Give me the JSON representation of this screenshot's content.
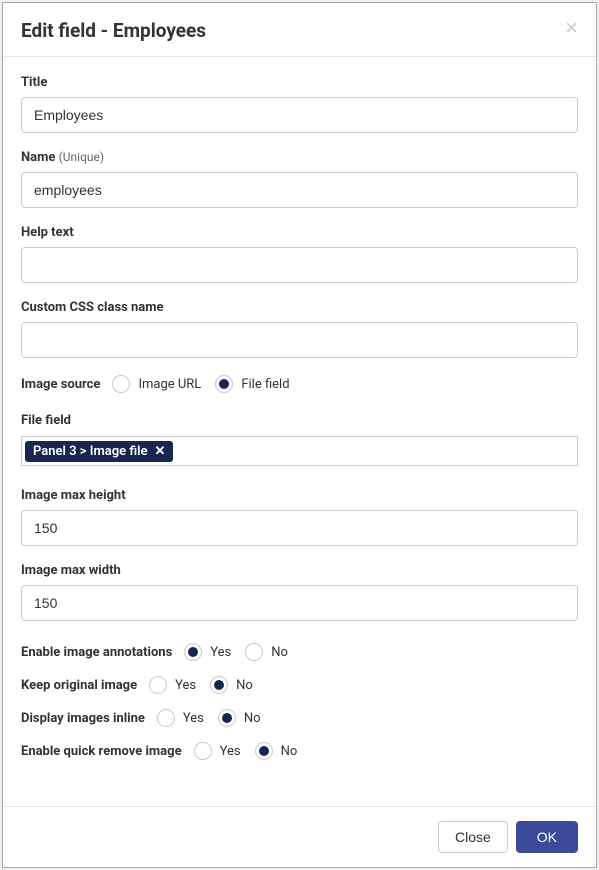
{
  "modal": {
    "title": "Edit field - Employees",
    "close_label": "×"
  },
  "fields": {
    "title": {
      "label": "Title",
      "value": "Employees"
    },
    "name": {
      "label": "Name",
      "hint": "(Unique)",
      "value": "employees"
    },
    "help_text": {
      "label": "Help text",
      "value": ""
    },
    "css_class": {
      "label": "Custom CSS class name",
      "value": ""
    },
    "image_source": {
      "label": "Image source",
      "options": [
        {
          "label": "Image URL",
          "selected": false
        },
        {
          "label": "File field",
          "selected": true
        }
      ]
    },
    "file_field": {
      "label": "File field",
      "tag_text": "Panel 3 > Image file",
      "tag_remove": "✕"
    },
    "max_height": {
      "label": "Image max height",
      "value": "150"
    },
    "max_width": {
      "label": "Image max width",
      "value": "150"
    },
    "annotations": {
      "label": "Enable image annotations",
      "options": [
        {
          "label": "Yes",
          "selected": true
        },
        {
          "label": "No",
          "selected": false
        }
      ]
    },
    "keep_original": {
      "label": "Keep original image",
      "options": [
        {
          "label": "Yes",
          "selected": false
        },
        {
          "label": "No",
          "selected": true
        }
      ]
    },
    "display_inline": {
      "label": "Display images inline",
      "options": [
        {
          "label": "Yes",
          "selected": false
        },
        {
          "label": "No",
          "selected": true
        }
      ]
    },
    "quick_remove": {
      "label": "Enable quick remove image",
      "options": [
        {
          "label": "Yes",
          "selected": false
        },
        {
          "label": "No",
          "selected": true
        }
      ]
    }
  },
  "footer": {
    "close_label": "Close",
    "ok_label": "OK"
  }
}
